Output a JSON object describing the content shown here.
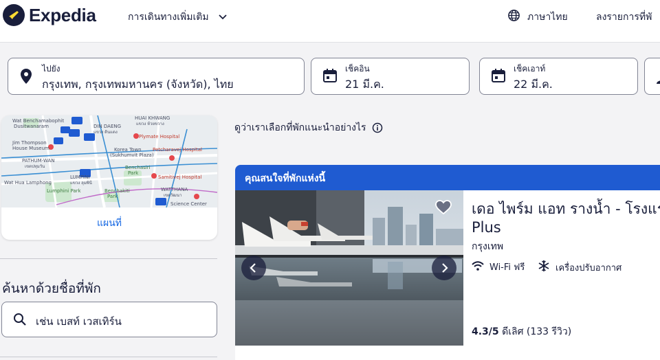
{
  "header": {
    "brand": "Expedia",
    "more_travel": "การเดินทางเพิ่มเติม",
    "language": "ภาษาไทย",
    "list_property": "ลงรายการที่พั"
  },
  "search": {
    "destination_label": "ไปยัง",
    "destination_value": "กรุงเทพ, กรุงเทพมหานคร (จังหวัด), ไทย",
    "checkin_label": "เช็คอิน",
    "checkin_value": "21 มี.ค.",
    "checkout_label": "เช็คเอาท์",
    "checkout_value": "22 มี.ค."
  },
  "map": {
    "link_label": "แผนที่",
    "labels": {
      "wat": "Wat Benchamabophit",
      "dusit": "Dusitwanaram",
      "din_daeng": "DIN DAENG",
      "din_daeng_th": "แขวง ดินแดง",
      "huai_khwang": "HUAI KHWANG",
      "huai_khwang_th": "แขวง ห้วยขวาง",
      "plymate": "Plymate Hospital",
      "jim": "Jim Thompson",
      "jim2": "House Museum",
      "pathum": "PATHUM-WAN",
      "pathum_th": "เขตปทุมวัน",
      "korea": "Korea Town",
      "korea2": "(Sukhumvit Plaza)",
      "petch": "Petcharavej Hospital",
      "benchasiri": "Benchasiri",
      "park": "Park",
      "lumpini": "LUMPINI",
      "lumpini_th": "แขวง ลุมพินี",
      "samitivej": "Samitivej Hospital",
      "lumphini_park": "Lumphini Park",
      "benchakiti": "Benchakiti",
      "park2": "Park",
      "watthana": "WATTHANA",
      "watthana_th": "เขตวัฒนา",
      "hua_lamphong": "Wat Hua Lamphong",
      "science": "Science Center"
    }
  },
  "sidebar": {
    "search_by_name_title": "ค้นหาด้วยชื่อที่พัก",
    "search_by_name_placeholder": "เช่น เบสท์ เวสเทิร์น"
  },
  "results": {
    "how_we_choose": "ดูว่าเราเลือกที่พักแนะนำอย่างไร",
    "banner": "คุณสนใจที่พักแห่งนี้",
    "hotel": {
      "name_line1": "เดอ ไพร์ม แอท รางน้ำ - โรงแร",
      "name_line2": "Plus",
      "city": "กรุงเทพ",
      "amenity_wifi": "Wi-Fi ฟรี",
      "amenity_ac": "เครื่องปรับอากาศ",
      "rating_score": "4.3/5",
      "rating_word": "ดีเลิศ",
      "rating_count": "(133 รีวิว)"
    }
  },
  "colors": {
    "brand_dark": "#191e3b",
    "banner_blue": "#1f5bd1",
    "link_blue": "#1668e3"
  }
}
